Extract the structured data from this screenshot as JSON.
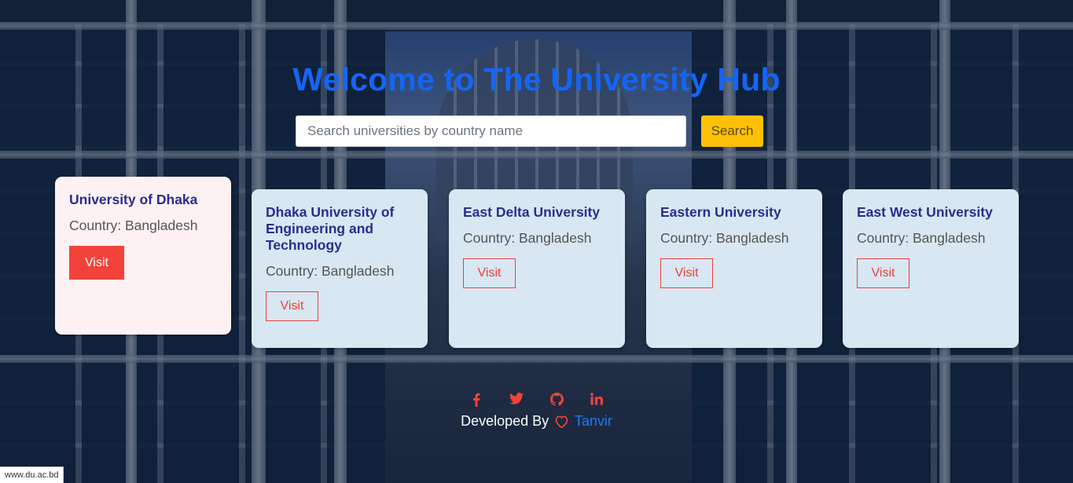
{
  "header": {
    "title": "Welcome to The University Hub"
  },
  "search": {
    "placeholder": "Search universities by country name",
    "value": "",
    "button_label": "Search"
  },
  "universities": [
    {
      "name": "University of Dhaka",
      "country": "Country: Bangladesh",
      "visit_label": "Visit",
      "hovered": true
    },
    {
      "name": "Dhaka University of Engineering and Technology",
      "country": "Country: Bangladesh",
      "visit_label": "Visit",
      "hovered": false
    },
    {
      "name": "East Delta University",
      "country": "Country: Bangladesh",
      "visit_label": "Visit",
      "hovered": false
    },
    {
      "name": "Eastern University",
      "country": "Country: Bangladesh",
      "visit_label": "Visit",
      "hovered": false
    },
    {
      "name": "East West University",
      "country": "Country: Bangladesh",
      "visit_label": "Visit",
      "hovered": false
    }
  ],
  "social_icons": [
    "facebook-icon",
    "twitter-icon",
    "github-icon",
    "linkedin-icon"
  ],
  "footer": {
    "prefix": "Developed By",
    "author": "Tanvir"
  },
  "status_bar": {
    "url": "www.du.ac.bd"
  },
  "colors": {
    "title": "#1565f5",
    "accent_red": "#f2433a",
    "search_button": "#ffc107",
    "card_bg": "#d8e7f2",
    "card_hover_bg": "#fdf1f3"
  }
}
